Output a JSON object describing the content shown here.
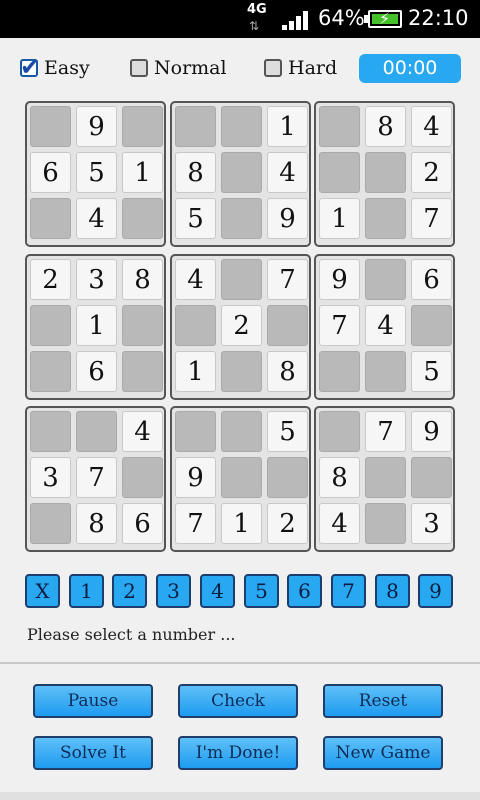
{
  "status": {
    "network": "4G",
    "battery_percent": "64%",
    "time": "22:10"
  },
  "difficulty": {
    "options": [
      {
        "label": "Easy",
        "checked": true
      },
      {
        "label": "Normal",
        "checked": false
      },
      {
        "label": "Hard",
        "checked": false
      }
    ],
    "timer": "00:00"
  },
  "board": {
    "blocks": [
      [
        [
          "",
          "9",
          ""
        ],
        [
          "6",
          "5",
          "1"
        ],
        [
          "",
          "4",
          ""
        ]
      ],
      [
        [
          "",
          "",
          "1"
        ],
        [
          "8",
          "",
          "4"
        ],
        [
          "5",
          "",
          "9"
        ]
      ],
      [
        [
          "",
          "8",
          "4"
        ],
        [
          "",
          "",
          "2"
        ],
        [
          "1",
          "",
          "7"
        ]
      ],
      [
        [
          "2",
          "3",
          "8"
        ],
        [
          "",
          "1",
          ""
        ],
        [
          "",
          "6",
          ""
        ]
      ],
      [
        [
          "4",
          "",
          "7"
        ],
        [
          "",
          "2",
          ""
        ],
        [
          "1",
          "",
          "8"
        ]
      ],
      [
        [
          "9",
          "",
          "6"
        ],
        [
          "7",
          "4",
          ""
        ],
        [
          "",
          "",
          "5"
        ]
      ],
      [
        [
          "",
          "",
          "4"
        ],
        [
          "3",
          "7",
          ""
        ],
        [
          "",
          "8",
          "6"
        ]
      ],
      [
        [
          "",
          "",
          "5"
        ],
        [
          "9",
          "",
          ""
        ],
        [
          "7",
          "1",
          "2"
        ]
      ],
      [
        [
          "",
          "7",
          "9"
        ],
        [
          "8",
          "",
          ""
        ],
        [
          "4",
          "",
          "3"
        ]
      ]
    ]
  },
  "numpad": {
    "keys": [
      "X",
      "1",
      "2",
      "3",
      "4",
      "5",
      "6",
      "7",
      "8",
      "9"
    ]
  },
  "hint": "Please select a number ...",
  "actions": {
    "pause": "Pause",
    "check": "Check",
    "reset": "Reset",
    "solve": "Solve It",
    "done": "I'm Done!",
    "new_game": "New Game"
  },
  "colors": {
    "accent": "#29a8f2",
    "empty_cell": "#b9b9b9",
    "filled_cell": "#f6f6f6"
  }
}
